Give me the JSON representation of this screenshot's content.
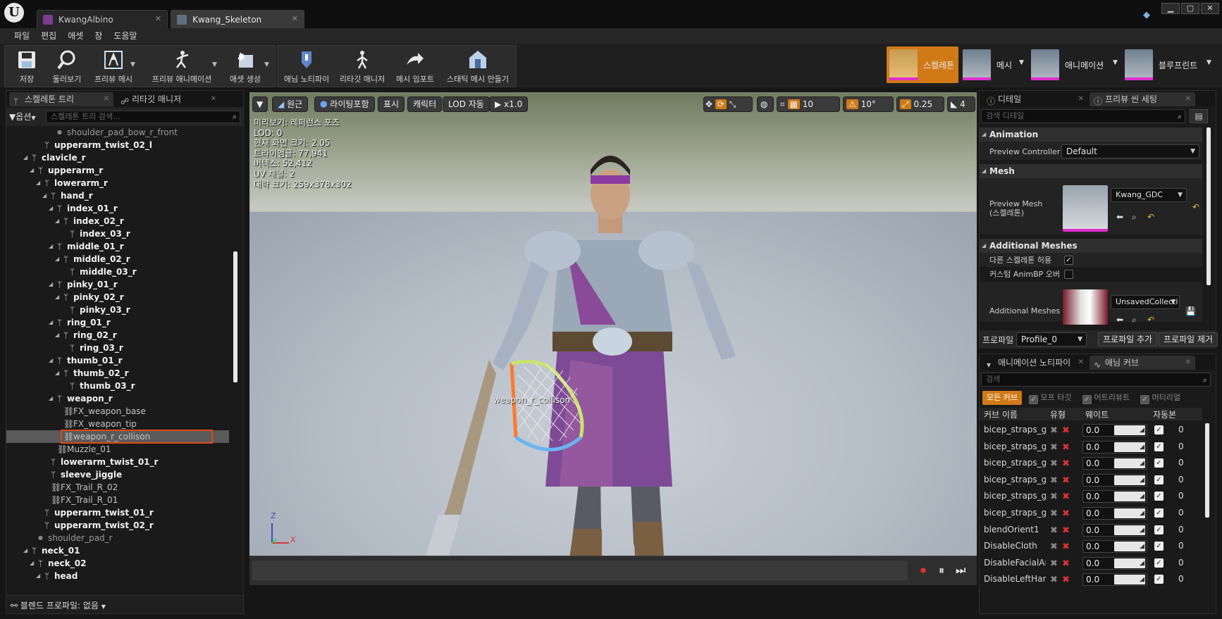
{
  "window": {
    "tabs": [
      {
        "label": "KwangAlbino",
        "active": false
      },
      {
        "label": "Kwang_Skeleton",
        "active": true
      }
    ]
  },
  "menu": [
    "파일",
    "편집",
    "애셋",
    "창",
    "도움말"
  ],
  "toolbar": {
    "buttons": [
      {
        "label": "저장",
        "icon": "save-icon"
      },
      {
        "label": "둘러보기",
        "icon": "browse-icon"
      },
      {
        "label": "프리뷰 메시",
        "icon": "preview-mesh-icon"
      },
      {
        "label": "프리뷰 애니메이션",
        "icon": "preview-animation-icon"
      },
      {
        "label": "애셋 생성",
        "icon": "create-asset-icon"
      },
      {
        "label": "애님 노티파이",
        "icon": "anim-notify-icon"
      },
      {
        "label": "리타깃 매니저",
        "icon": "retarget-manager-icon"
      },
      {
        "label": "메시 임포트",
        "icon": "import-mesh-icon"
      },
      {
        "label": "스태틱 메시 만들기",
        "icon": "make-static-mesh-icon"
      }
    ],
    "modes": [
      "스켈레톤",
      "메시",
      "애니메이션",
      "블루프린트"
    ],
    "active_mode": "스켈레톤",
    "accent": "#d07a17"
  },
  "left": {
    "tabs": [
      "스켈레톤 트리",
      "리타깃 매니저"
    ],
    "options_label": "옵션",
    "search_placeholder": "스켈레톤 트리 검색...",
    "tree": [
      {
        "label": "shoulder_pad_bow_r_front",
        "kind": "dim",
        "depth": 6
      },
      {
        "label": "upperarm_twist_02_l",
        "kind": "bone",
        "depth": 4
      },
      {
        "label": "clavicle_r",
        "kind": "bone",
        "depth": 2,
        "expanded": true
      },
      {
        "label": "upperarm_r",
        "kind": "bone",
        "depth": 3,
        "expanded": true
      },
      {
        "label": "lowerarm_r",
        "kind": "bone",
        "depth": 4,
        "expanded": true
      },
      {
        "label": "hand_r",
        "kind": "bone",
        "depth": 5,
        "expanded": true
      },
      {
        "label": "index_01_r",
        "kind": "bone",
        "depth": 6,
        "expanded": true
      },
      {
        "label": "index_02_r",
        "kind": "bone",
        "depth": 7,
        "expanded": true
      },
      {
        "label": "index_03_r",
        "kind": "bone",
        "depth": 8
      },
      {
        "label": "middle_01_r",
        "kind": "bone",
        "depth": 6,
        "expanded": true
      },
      {
        "label": "middle_02_r",
        "kind": "bone",
        "depth": 7,
        "expanded": true
      },
      {
        "label": "middle_03_r",
        "kind": "bone",
        "depth": 8
      },
      {
        "label": "pinky_01_r",
        "kind": "bone",
        "depth": 6,
        "expanded": true
      },
      {
        "label": "pinky_02_r",
        "kind": "bone",
        "depth": 7,
        "expanded": true
      },
      {
        "label": "pinky_03_r",
        "kind": "bone",
        "depth": 8
      },
      {
        "label": "ring_01_r",
        "kind": "bone",
        "depth": 6,
        "expanded": true
      },
      {
        "label": "ring_02_r",
        "kind": "bone",
        "depth": 7,
        "expanded": true
      },
      {
        "label": "ring_03_r",
        "kind": "bone",
        "depth": 8
      },
      {
        "label": "thumb_01_r",
        "kind": "bone",
        "depth": 6,
        "expanded": true
      },
      {
        "label": "thumb_02_r",
        "kind": "bone",
        "depth": 7,
        "expanded": true
      },
      {
        "label": "thumb_03_r",
        "kind": "bone",
        "depth": 8
      },
      {
        "label": "weapon_r",
        "kind": "bone",
        "depth": 6,
        "expanded": true
      },
      {
        "label": "FX_weapon_base",
        "kind": "socket",
        "depth": 7
      },
      {
        "label": "FX_weapon_tip",
        "kind": "socket",
        "depth": 7
      },
      {
        "label": "weapon_r_collison",
        "kind": "socket",
        "depth": 7,
        "selected": true
      },
      {
        "label": "Muzzle_01",
        "kind": "socket",
        "depth": 6
      },
      {
        "label": "lowerarm_twist_01_r",
        "kind": "bone",
        "depth": 5
      },
      {
        "label": "sleeve_jiggle",
        "kind": "bone",
        "depth": 5
      },
      {
        "label": "FX_Trail_R_02",
        "kind": "socket",
        "depth": 5
      },
      {
        "label": "FX_Trail_R_01",
        "kind": "socket",
        "depth": 5
      },
      {
        "label": "upperarm_twist_01_r",
        "kind": "bone",
        "depth": 4
      },
      {
        "label": "upperarm_twist_02_r",
        "kind": "bone",
        "depth": 4
      },
      {
        "label": "shoulder_pad_r",
        "kind": "dim",
        "depth": 3
      },
      {
        "label": "neck_01",
        "kind": "bone",
        "depth": 2,
        "expanded": true
      },
      {
        "label": "neck_02",
        "kind": "bone",
        "depth": 3,
        "expanded": true
      },
      {
        "label": "head",
        "kind": "bone",
        "depth": 4,
        "expanded": true
      }
    ],
    "footer": "블렌드 프로파일: 없음"
  },
  "viewport": {
    "buttons": [
      "원근",
      "라이팅포함",
      "표시",
      "캐릭터",
      "LOD 자동",
      "x1.0"
    ],
    "info": [
      "미리보기: 레퍼런스 포즈",
      "LOD: 0",
      "현재 화면 크기: 2.05",
      "트라이앵글: 77,941",
      "버텍스: 52,412",
      "UV 채널: 2",
      "대략 크기: 259x378x302"
    ],
    "grid_snap": "10",
    "rot_snap": "10°",
    "scale_snap": "0.25",
    "camera_speed": "4",
    "collision_label": "weapon_r_collison",
    "axis_z": "Z",
    "axis_x": "X"
  },
  "details": {
    "tabs": [
      "디테일",
      "프리뷰 씬 세팅"
    ],
    "search_placeholder": "검색 디테일",
    "animation_section": "Animation",
    "preview_controller_label": "Preview Controller",
    "preview_controller_value": "Default",
    "mesh_section": "Mesh",
    "preview_mesh_label": "Preview Mesh\n(스켈레톤)",
    "preview_mesh_value": "Kwang_GDC",
    "additional_section": "Additional Meshes",
    "allow_diff_skeleton": "다른 스켈레톤 허용",
    "custom_animbp": "커스텀 AnimBP 오버",
    "additional_meshes_label": "Additional Meshes",
    "additional_meshes_value": "UnsavedCollecti",
    "profile_label": "프로파일",
    "profile_value": "Profile_0",
    "add_profile": "프로파일 추가",
    "remove_profile": "프로파일 제거"
  },
  "curves": {
    "tabs": [
      "애니메이션 노티파이",
      "애님 커브"
    ],
    "search_placeholder": "검색",
    "filters": [
      "모든 커브",
      "모프 타깃",
      "어트리뷰트",
      "머티리얼"
    ],
    "headers": [
      "커브 이름",
      "유형",
      "웨이트",
      "자동",
      "본"
    ],
    "rows": [
      {
        "name": "bicep_straps_geo",
        "weight": "0.0",
        "num": "0"
      },
      {
        "name": "bicep_straps_geo",
        "weight": "0.0",
        "num": "0"
      },
      {
        "name": "bicep_straps_geo",
        "weight": "0.0",
        "num": "0"
      },
      {
        "name": "bicep_straps_geo",
        "weight": "0.0",
        "num": "0"
      },
      {
        "name": "bicep_straps_geo",
        "weight": "0.0",
        "num": "0"
      },
      {
        "name": "bicep_straps_geo",
        "weight": "0.0",
        "num": "0"
      },
      {
        "name": "blendOrient1",
        "weight": "0.0",
        "num": "0"
      },
      {
        "name": "DisableCloth",
        "weight": "0.0",
        "num": "0"
      },
      {
        "name": "DisableFacialAn",
        "weight": "0.0",
        "num": "0"
      },
      {
        "name": "DisableLeftHand",
        "weight": "0.0",
        "num": "0"
      }
    ]
  }
}
